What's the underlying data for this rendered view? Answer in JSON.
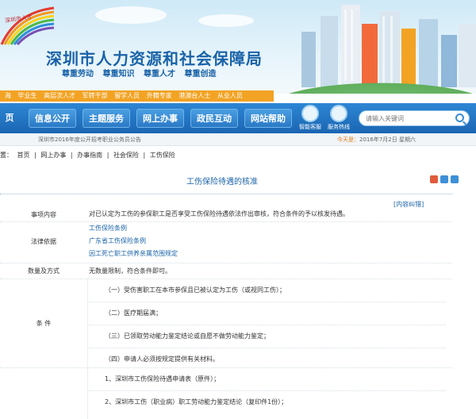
{
  "header": {
    "logo_text": "深圳市人才",
    "site_title": "深圳市人力资源和社会保障局",
    "slogans": [
      "尊重劳动",
      "尊重知识",
      "尊重人才",
      "尊重创造"
    ]
  },
  "talent_strip": [
    "海",
    "毕业生",
    "高层次人才",
    "军转干部",
    "留学人员",
    "外籍专家",
    "港澳台人士",
    "从业人员"
  ],
  "nav": {
    "items": [
      "页",
      "信息公开",
      "主题服务",
      "网上办事",
      "政民互动",
      "网站帮助"
    ],
    "icons": [
      {
        "name": "robot-icon",
        "label": "智能客服"
      },
      {
        "name": "service-icon",
        "label": "服务热线"
      }
    ],
    "search_placeholder": "请输入关键词"
  },
  "notice": {
    "marquee": "深圳市2016年度公开招考职业公务员公告",
    "today_label": "今天是：",
    "today_value": "2016年7月2日 星期六"
  },
  "breadcrumb": [
    "置：",
    "首页",
    "|",
    "网上办事",
    "|",
    "办事指南",
    "|",
    "社会保险",
    "|",
    "工伤保险"
  ],
  "page": {
    "title": "工伤保险待遇的核准",
    "correction": "[内容纠错]"
  },
  "table": {
    "matter_label": "事项内容",
    "matter_value": "对已认定为工伤的参保职工是否享受工伤保险待遇依法作出审核，符合条件的予以核发待遇。",
    "basis_label": "法律依据",
    "basis_links": [
      "工伤保险条例",
      "广东省工伤保险条例",
      "因工死亡职工供养亲属范围规定"
    ],
    "quantity_label": "数量及方式",
    "quantity_value": "无数量限制，符合条件即可。",
    "condition_label": "条        件",
    "conditions": [
      "（一）受伤害职工在本市参保且已被认定为工伤（或视同工伤）；",
      "（二）医疗期届满；",
      "（三）已领取劳动能力鉴定结论或自愿不做劳动能力鉴定；",
      "（四）申请人必须按规定提供有关材料。"
    ],
    "materials": [
      "1、深圳市工伤保险待遇申请表（原件）；",
      "2、深圳市工伤（职业病）职工劳动能力鉴定结论（复印件1份）；"
    ]
  },
  "colors": {
    "brand_blue": "#1a63a8",
    "nav_blue": "#1b66b3",
    "strip_orange": "#f2a324"
  }
}
